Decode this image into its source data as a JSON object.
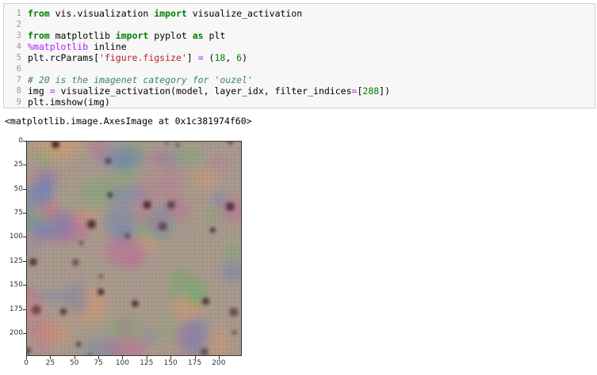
{
  "cell": {
    "line_numbers": [
      "1",
      "2",
      "3",
      "4",
      "5",
      "6",
      "7",
      "8",
      "9"
    ]
  },
  "code": {
    "l1": {
      "kw1": "from",
      "mod": " vis.visualization ",
      "kw2": "import",
      "name": " visualize_activation"
    },
    "l3": {
      "kw1": "from",
      "mod": " matplotlib ",
      "kw2": "import",
      "mid": " pyplot ",
      "kw3": "as",
      "name": " plt"
    },
    "l4": {
      "magic": "%matplotlib",
      "rest": " inline"
    },
    "l5": {
      "a": "plt.rcParams[",
      "s": "'figure.figsize'",
      "b": "] ",
      "op": "=",
      "c": " (",
      "n1": "18",
      "d": ", ",
      "n2": "6",
      "e": ")"
    },
    "l7": {
      "comment": "# 20 is the imagenet category for 'ouzel'"
    },
    "l8": {
      "a": "img ",
      "op": "=",
      "b": " visualize_activation(model, layer_idx, filter_indices",
      "op2": "=",
      "c": "[",
      "n": "288",
      "d": "])"
    },
    "l9": {
      "text": "plt.imshow(img)"
    }
  },
  "output": {
    "repr": "<matplotlib.image.AxesImage at 0x1c381974f60>"
  },
  "chart_data": {
    "type": "heatmap",
    "y_ticks": [
      "0",
      "25",
      "50",
      "75",
      "100",
      "125",
      "150",
      "175",
      "200"
    ],
    "x_ticks": [
      "0",
      "25",
      "50",
      "75",
      "100",
      "125",
      "150",
      "175",
      "200"
    ],
    "xlim": [
      0,
      224
    ],
    "ylim": [
      224,
      0
    ],
    "image": "activation maximization visualization",
    "colors": {
      "base": "#a89a8c",
      "accents": [
        "#6fae6a",
        "#c06a9a",
        "#5e7fbf",
        "#d89a6a",
        "#3a1a22"
      ]
    }
  }
}
